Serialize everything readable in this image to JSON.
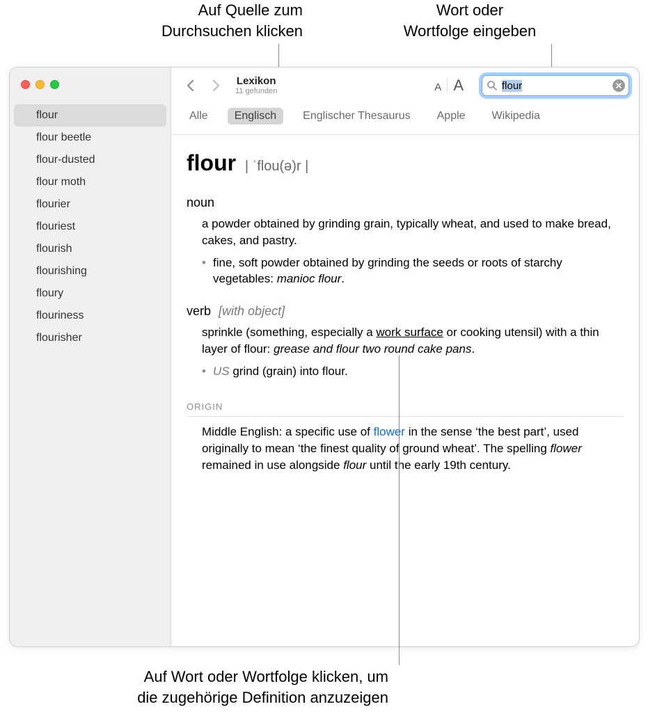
{
  "callouts": {
    "top_left": "Auf Quelle zum\nDurchsuchen klicken",
    "top_right": "Wort oder\nWortfolge eingeben",
    "bottom": "Auf Wort oder Wortfolge klicken, um\ndie zugehörige Definition anzuzeigen"
  },
  "toolbar": {
    "title": "Lexikon",
    "subtitle": "11 gefunden",
    "font_small": "A",
    "font_large": "A"
  },
  "search": {
    "value": "flour"
  },
  "source_tabs": [
    "Alle",
    "Englisch",
    "Englischer Thesaurus",
    "Apple",
    "Wikipedia"
  ],
  "source_tabs_active_index": 1,
  "sidebar": {
    "items": [
      "flour",
      "flour beetle",
      "flour-dusted",
      "flour moth",
      "flourier",
      "flouriest",
      "flourish",
      "flourishing",
      "floury",
      "flouriness",
      "flourisher"
    ],
    "selected_index": 0
  },
  "entry": {
    "headword": "flour",
    "pronunciation": "| ˈflou(ə)r |",
    "pos_noun": "noun",
    "noun_def": "a powder obtained by grinding grain, typically wheat, and used to make bread, cakes, and pastry.",
    "noun_sub": "fine, soft powder obtained by grinding the seeds or roots of starchy vegetables: ",
    "noun_sub_example": "manioc flour",
    "noun_sub_period": ".",
    "pos_verb": "verb",
    "pos_verb_extra": "[with object]",
    "verb_def_pre": "sprinkle (something, especially a ",
    "verb_def_underlined": "work surface",
    "verb_def_post": " or cooking utensil) with a thin layer of flour: ",
    "verb_example": "grease and flour two round cake pans",
    "verb_example_period": ".",
    "verb_sub_region": "US ",
    "verb_sub_text": "grind (grain) into flour.",
    "origin_head": "ORIGIN",
    "origin_pre": "Middle English: a specific use of ",
    "origin_link": "flower",
    "origin_mid": " in the sense ‘the best part’, used originally to mean ‘the finest quality of ground wheat’. The spelling ",
    "origin_italic1": "flower",
    "origin_mid2": " remained in use alongside ",
    "origin_italic2": "flour",
    "origin_end": " until the early 19th century."
  }
}
